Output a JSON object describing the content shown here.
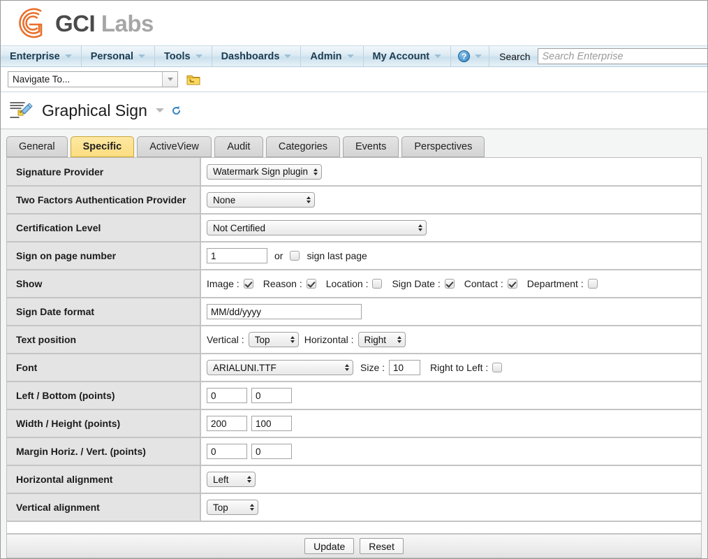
{
  "brand": {
    "logo_icon": "gci-g-logo-icon",
    "name_primary": "GCI",
    "name_secondary": "Labs",
    "logo_color": "#e8702a",
    "primary_text_color": "#4a4a4a",
    "secondary_text_color": "#a6a6a6"
  },
  "navbar": {
    "items": [
      {
        "label": "Enterprise",
        "has_caret": true
      },
      {
        "label": "Personal",
        "has_caret": true
      },
      {
        "label": "Tools",
        "has_caret": true
      },
      {
        "label": "Dashboards",
        "has_caret": true
      },
      {
        "label": "Admin",
        "has_caret": true
      },
      {
        "label": "My Account",
        "has_caret": true
      }
    ],
    "help_icon": "question-mark-circle-icon",
    "help_glyph": "?",
    "search_label": "Search",
    "search_placeholder": "Search Enterprise",
    "search_value": "",
    "accent_color": "#cbe0ed",
    "text_color": "#1d3c52"
  },
  "toolbar": {
    "navigate_select_value": "Navigate To...",
    "folder_icon": "open-folder-icon"
  },
  "page": {
    "title": "Graphical Sign",
    "title_icon": "signature-pen-document-icon",
    "caret_icon": "chevron-down-icon",
    "refresh_icon": "refresh-icon"
  },
  "tabs": [
    {
      "label": "General",
      "active": false
    },
    {
      "label": "Specific",
      "active": true
    },
    {
      "label": "ActiveView",
      "active": false
    },
    {
      "label": "Audit",
      "active": false
    },
    {
      "label": "Categories",
      "active": false
    },
    {
      "label": "Events",
      "active": false
    },
    {
      "label": "Perspectives",
      "active": false
    }
  ],
  "form": {
    "signature_provider": {
      "label": "Signature Provider",
      "value": "Watermark Sign plugin"
    },
    "two_factors": {
      "label": "Two Factors Authentication Provider",
      "value": "None"
    },
    "certification_level": {
      "label": "Certification Level",
      "value": "Not Certified"
    },
    "sign_on_page": {
      "label": "Sign on page number",
      "page_value": "1",
      "or_text": "or",
      "last_page_label": "sign last page",
      "last_page_checked": false
    },
    "show": {
      "label": "Show",
      "options": [
        {
          "label": "Image :",
          "checked": true
        },
        {
          "label": "Reason :",
          "checked": true
        },
        {
          "label": "Location :",
          "checked": false
        },
        {
          "label": "Sign Date :",
          "checked": true
        },
        {
          "label": "Contact :",
          "checked": true
        },
        {
          "label": "Department :",
          "checked": false
        }
      ]
    },
    "sign_date_format": {
      "label": "Sign Date format",
      "value": "MM/dd/yyyy"
    },
    "text_position": {
      "label": "Text position",
      "vertical_label": "Vertical :",
      "vertical_value": "Top",
      "horizontal_label": "Horizontal :",
      "horizontal_value": "Right"
    },
    "font": {
      "label": "Font",
      "value": "ARIALUNI.TTF",
      "size_label": "Size :",
      "size_value": "10",
      "rtl_label": "Right to Left :",
      "rtl_checked": false
    },
    "left_bottom": {
      "label": "Left / Bottom (points)",
      "left_value": "0",
      "bottom_value": "0"
    },
    "width_height": {
      "label": "Width / Height (points)",
      "width_value": "200",
      "height_value": "100"
    },
    "margin": {
      "label": "Margin Horiz. / Vert. (points)",
      "horiz_value": "0",
      "vert_value": "0"
    },
    "horizontal_alignment": {
      "label": "Horizontal alignment",
      "value": "Left"
    },
    "vertical_alignment": {
      "label": "Vertical alignment",
      "value": "Top"
    }
  },
  "footer": {
    "update_label": "Update",
    "reset_label": "Reset"
  }
}
